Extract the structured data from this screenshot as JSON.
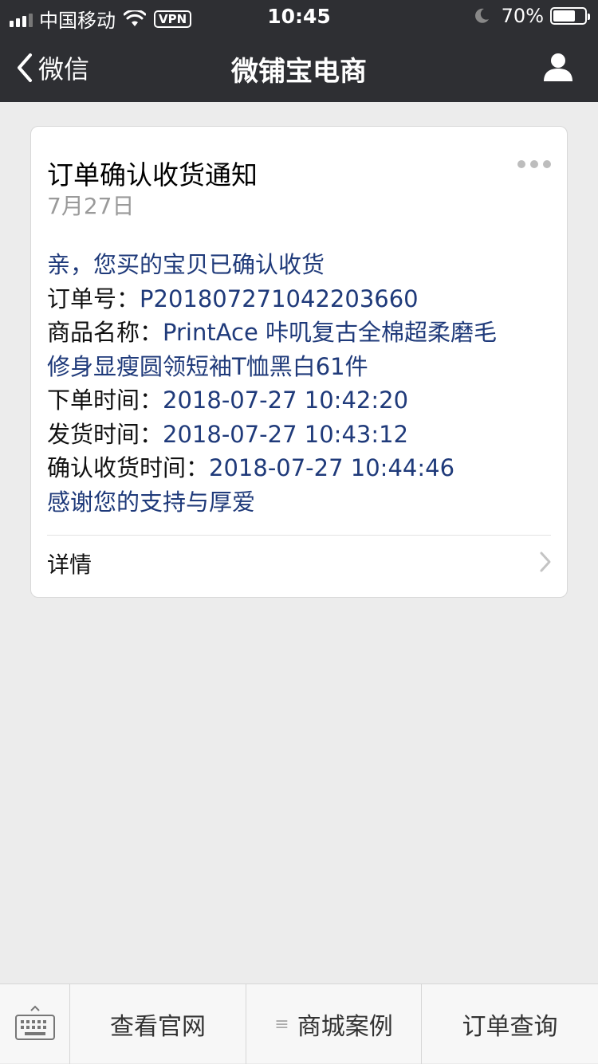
{
  "status_bar": {
    "carrier": "中国移动",
    "vpn": "VPN",
    "time": "10:45",
    "battery_pct": "70%",
    "battery_level": 0.7
  },
  "nav": {
    "back_label": "微信",
    "title": "微铺宝电商"
  },
  "card": {
    "title": "订单确认收货通知",
    "date": "7月27日",
    "greeting": "亲，您买的宝贝已确认收货",
    "order_no_label": "订单号：",
    "order_no": "P201807271042203660",
    "product_label": "商品名称：",
    "product_line1": "PrintAce 咔叽复古全棉超柔磨毛",
    "product_line2": "修身显瘦圆领短袖T恤黑白61件",
    "order_time_label": "下单时间：",
    "order_time": "2018-07-27 10:42:20",
    "ship_time_label": "发货时间：",
    "ship_time": "2018-07-27 10:43:12",
    "confirm_time_label": "确认收货时间：",
    "confirm_time": "2018-07-27 10:44:46",
    "thanks": "感谢您的支持与厚爱",
    "detail_label": "详情"
  },
  "bottom_menu": {
    "items": [
      {
        "label": "查看官网"
      },
      {
        "label": "商城案例",
        "has_submenu": true
      },
      {
        "label": "订单查询"
      }
    ]
  },
  "colors": {
    "bar_bg": "#2e2f33",
    "page_bg": "#ececec",
    "value_blue": "#1f3a7a",
    "date_gray": "#9a9a9a"
  }
}
